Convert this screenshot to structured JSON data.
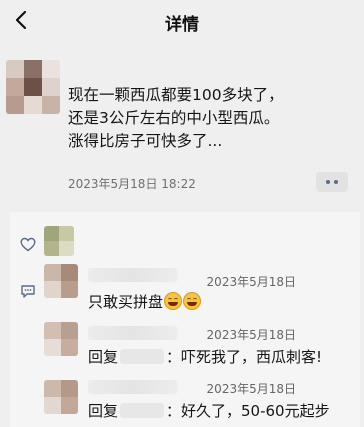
{
  "header": {
    "title": "详情"
  },
  "post": {
    "lines": [
      "现在一颗西瓜都要100多块了，",
      "还是3公斤左右的中小型西瓜。",
      "涨得比房子可快多了..."
    ],
    "time": "2023年5月18日 18:22"
  },
  "comments": [
    {
      "time": "2023年5月18日",
      "text": "只敢买拼盘"
    },
    {
      "time": "2023年5月18日",
      "reply_prefix": "回复",
      "text": "：吓死我了，西瓜刺客!"
    },
    {
      "time": "2023年5月18日",
      "reply_prefix": "回复",
      "text": "：好久了，50-60元起步"
    }
  ],
  "icons": [
    "back-icon",
    "more-icon",
    "like-icon",
    "comment-icon",
    "emoji-icon"
  ],
  "colors": {
    "background": "#efefef",
    "panel": "#f5f5f5",
    "text": "#151515",
    "meta": "#6f6f6f"
  }
}
